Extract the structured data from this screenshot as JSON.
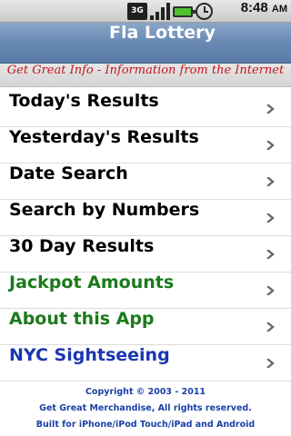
{
  "status_bar": {
    "network_label": "3G",
    "time": "8:48",
    "ampm": "AM"
  },
  "title_bar": {
    "title": "Fla Lottery"
  },
  "banner": {
    "text": "Get Great Info - Information from the Internet",
    "color": "#c4161c"
  },
  "menu": {
    "items": [
      {
        "label": "Today's Results",
        "color": "#000000"
      },
      {
        "label": "Yesterday's Results",
        "color": "#000000"
      },
      {
        "label": "Date Search",
        "color": "#000000"
      },
      {
        "label": "Search by Numbers",
        "color": "#000000"
      },
      {
        "label": "30 Day Results",
        "color": "#000000"
      },
      {
        "label": "Jackpot Amounts",
        "color": "#1b7a1b"
      },
      {
        "label": "About this App",
        "color": "#1b7a1b"
      },
      {
        "label": "NYC Sightseeing",
        "color": "#1b36b0"
      }
    ],
    "chevron_icon": "chevron-right-icon"
  },
  "footer": {
    "line1": "Copyright © 2003 - 2011",
    "line2": "Get Great Merchandise, All rights reserved.",
    "line3": "Built for iPhone/iPod Touch/iPad and Android"
  }
}
